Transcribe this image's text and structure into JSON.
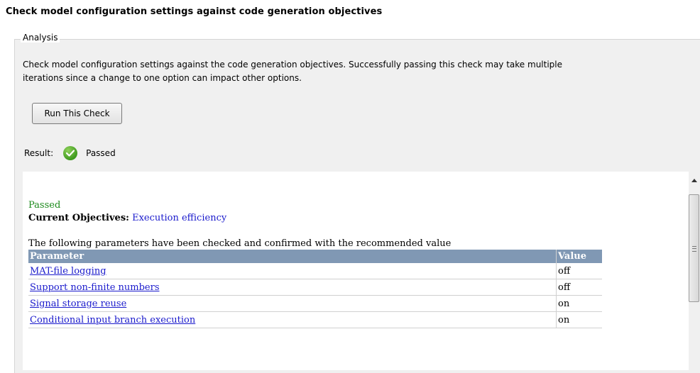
{
  "title": "Check model configuration settings against code generation objectives",
  "analysis": {
    "legend": "Analysis",
    "description_line1": "Check model configuration settings against the code generation objectives. Successfully passing this check may take multiple",
    "description_line2": "iterations since a change to one option can impact other options.",
    "run_button_label": "Run This Check",
    "result_label": "Result:",
    "result_icon": "check-circle-icon",
    "result_value": "Passed"
  },
  "report": {
    "status": "Passed",
    "objectives_label": "Current Objectives:",
    "objectives_value": "Execution efficiency",
    "intro": "The following parameters have been checked and confirmed with the recommended value",
    "columns": [
      "Parameter",
      "Value"
    ],
    "rows": [
      {
        "parameter": "MAT-file logging",
        "value": "off"
      },
      {
        "parameter": "Support non-finite numbers",
        "value": "off"
      },
      {
        "parameter": "Signal storage reuse",
        "value": "on"
      },
      {
        "parameter": "Conditional input branch execution",
        "value": "on"
      }
    ]
  },
  "colors": {
    "passed_green": "#1c8a1c",
    "link_blue": "#1a1acc",
    "table_header": "#8098b4"
  }
}
